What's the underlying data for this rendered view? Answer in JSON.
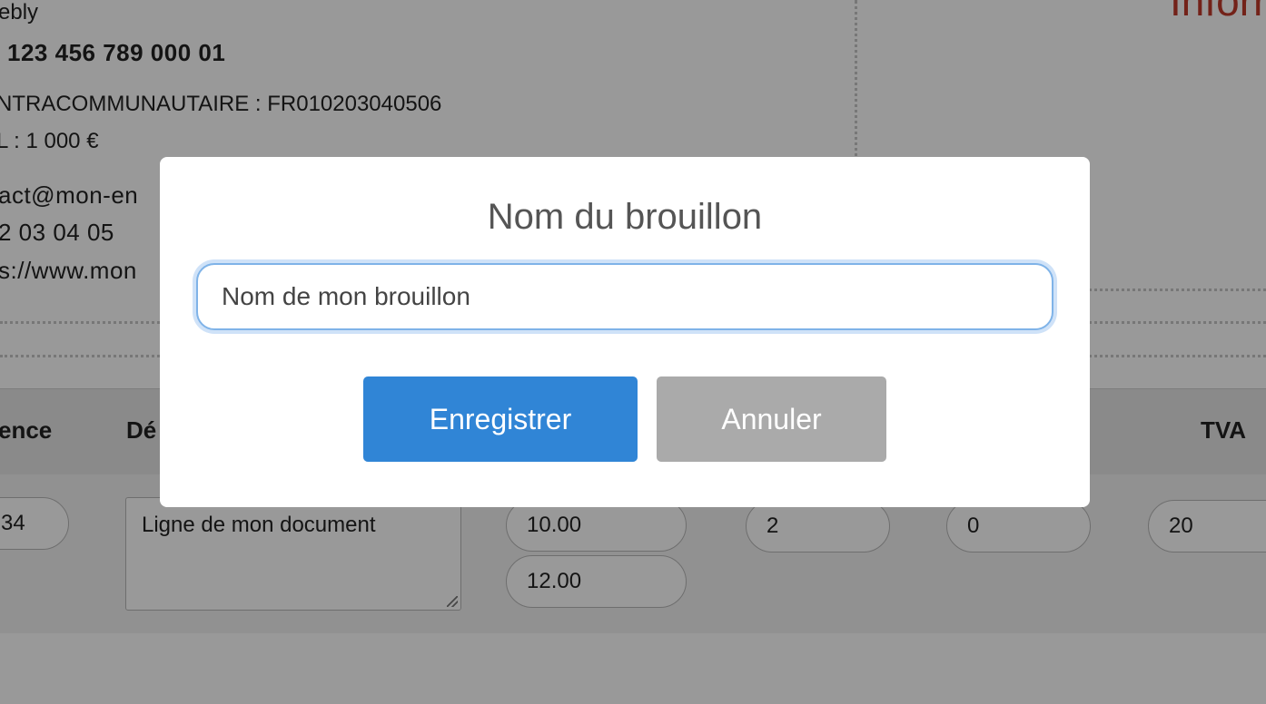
{
  "company": {
    "name_partial": "ebly",
    "siret_partial": "123 456 789 000 01",
    "tva_intra_label_partial": "NTRACOMMUNAUTAIRE",
    "tva_intra_value": ": FR010203040506",
    "capital_partial": "L : 1 000 €",
    "email_partial": "act@mon-en",
    "phone_partial": "2 03 04 05",
    "website_partial": "s://www.mon"
  },
  "info_title_partial": "Inforr",
  "table": {
    "headers": [
      "ence",
      "Dé",
      "TVA"
    ],
    "row": {
      "reference_partial": "34",
      "description": "Ligne de mon document",
      "price_ht": "10.00",
      "price_ttc": "12.00",
      "quantity": "2",
      "discount": "0",
      "tva": "20"
    }
  },
  "modal": {
    "title": "Nom du brouillon",
    "input_value": "Nom de mon brouillon",
    "save_label": "Enregistrer",
    "cancel_label": "Annuler"
  },
  "colors": {
    "primary_button": "#3085d6",
    "cancel_button": "#aaaaaa",
    "info_title": "#c0392b"
  }
}
